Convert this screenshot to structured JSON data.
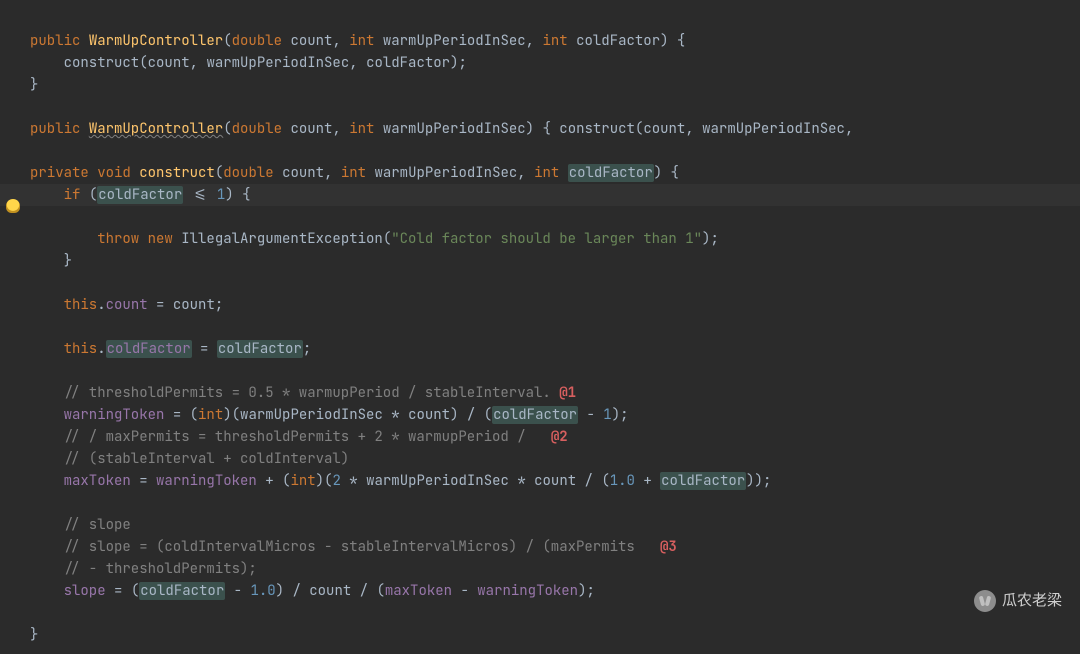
{
  "code": {
    "l1_public": "public",
    "l1_ctor": "WarmUpController",
    "l1_double": "double",
    "l1_count": "count",
    "l1_int1": "int",
    "l1_warm": "warmUpPeriodInSec",
    "l1_int2": "int",
    "l1_cold": "coldFactor",
    "l2_call": "construct",
    "l2_count": "count",
    "l2_warm": "warmUpPeriodInSec",
    "l2_cold": "coldFactor",
    "l4_public": "public",
    "l4_ctor": "WarmUpController",
    "l4_double": "double",
    "l4_count": "count",
    "l4_int": "int",
    "l4_warm": "warmUpPeriodInSec",
    "l4_call": "construct",
    "l4_arg1": "count",
    "l4_arg2": "warmUpPeriodInSec",
    "l5_private": "private",
    "l5_void": "void",
    "l5_name": "construct",
    "l5_double": "double",
    "l5_count": "count",
    "l5_int1": "int",
    "l5_warm": "warmUpPeriodInSec",
    "l5_int2": "int",
    "l5_cold": "coldFactor",
    "l6_if": "if",
    "l6_cold": "coldFactor",
    "l6_op": "<=",
    "l6_one": "1",
    "l7_throw": "throw",
    "l7_new": "new",
    "l7_ex": "IllegalArgumentException",
    "l7_msg": "\"Cold factor should be larger than 1\"",
    "l9_this": "this",
    "l9_count_f": "count",
    "l9_count_v": "count",
    "l10_this": "this",
    "l10_cf_f": "coldFactor",
    "l10_cf_v": "coldFactor",
    "c1": "// thresholdPermits = 0.5 * warmupPeriod / stableInterval.",
    "c1_anno": "@1",
    "l12_wt": "warningToken",
    "l12_int": "int",
    "l12_warm": "warmUpPeriodInSec",
    "l12_count": "count",
    "l12_cold": "coldFactor",
    "l12_one": "1",
    "c2a": "// / maxPermits = thresholdPermits + 2 * warmupPeriod /",
    "c2_anno": "@2",
    "c2b": "// (stableInterval + coldInterval)",
    "l14_max": "maxToken",
    "l14_wt": "warningToken",
    "l14_int": "int",
    "l14_two": "2",
    "l14_warm": "warmUpPeriodInSec",
    "l14_count": "count",
    "l14_one": "1.0",
    "l14_cold": "coldFactor",
    "c3a": "// slope",
    "c3b": "// slope = (coldIntervalMicros - stableIntervalMicros) / (maxPermits",
    "c3_anno": "@3",
    "c3c": "// - thresholdPermits);",
    "l16_slope": "slope",
    "l16_cold": "coldFactor",
    "l16_one": "1.0",
    "l16_count": "count",
    "l16_max": "maxToken",
    "l16_wt": "warningToken"
  },
  "watermark": "瓜农老梁"
}
